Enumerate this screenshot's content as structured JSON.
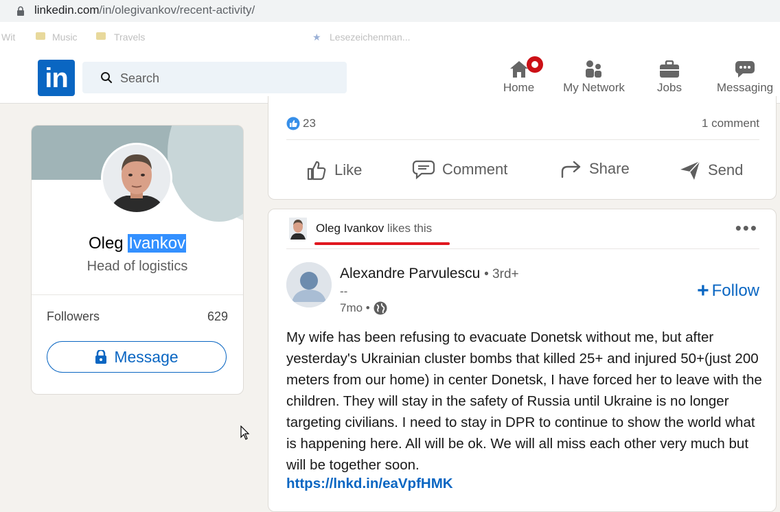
{
  "browser": {
    "url_domain": "linkedin.com",
    "url_path": "/in/olegivankov/recent-activity/",
    "bookmarks": [
      "Wit",
      "Music",
      "Travels",
      "Lesezeichenman..."
    ]
  },
  "nav": {
    "logo": "in",
    "search_placeholder": "Search",
    "items": [
      {
        "label": "Home",
        "icon": "home-icon"
      },
      {
        "label": "My Network",
        "icon": "network-icon"
      },
      {
        "label": "Jobs",
        "icon": "briefcase-icon"
      },
      {
        "label": "Messaging",
        "icon": "messaging-icon"
      }
    ]
  },
  "profile": {
    "first_name": "Oleg",
    "last_name": "Ivankov",
    "title": "Head of logistics",
    "followers_label": "Followers",
    "followers_count": "629",
    "message_label": "Message"
  },
  "post1": {
    "reactions_count": "23",
    "comments": "1 comment",
    "actions": [
      "Like",
      "Comment",
      "Share",
      "Send"
    ]
  },
  "post2": {
    "liker_name": "Oleg Ivankov",
    "liker_suffix": "likes this",
    "author_name": "Alexandre Parvulescu",
    "author_degree": "• 3rd+",
    "author_headline": "--",
    "time": "7mo •",
    "follow_label": "Follow",
    "body": "My wife has been refusing to evacuate Donetsk without me, but after yesterday's Ukrainian cluster bombs that killed 25+ and injured 50+(just 200 meters from our home) in center Donetsk, I have forced her to leave with the children. They will stay in the safety of Russia until Ukraine is no longer targeting civilians. I need to stay in DPR to continue to show the world what is happening here. All will be ok. We will all miss each other very much but will be together soon.",
    "link": "https://lnkd.in/eaVpfHMK"
  },
  "colors": {
    "accent": "#0a66c2",
    "notification": "#cc1016",
    "underline": "#e0161f",
    "selection": "#3390ff"
  }
}
